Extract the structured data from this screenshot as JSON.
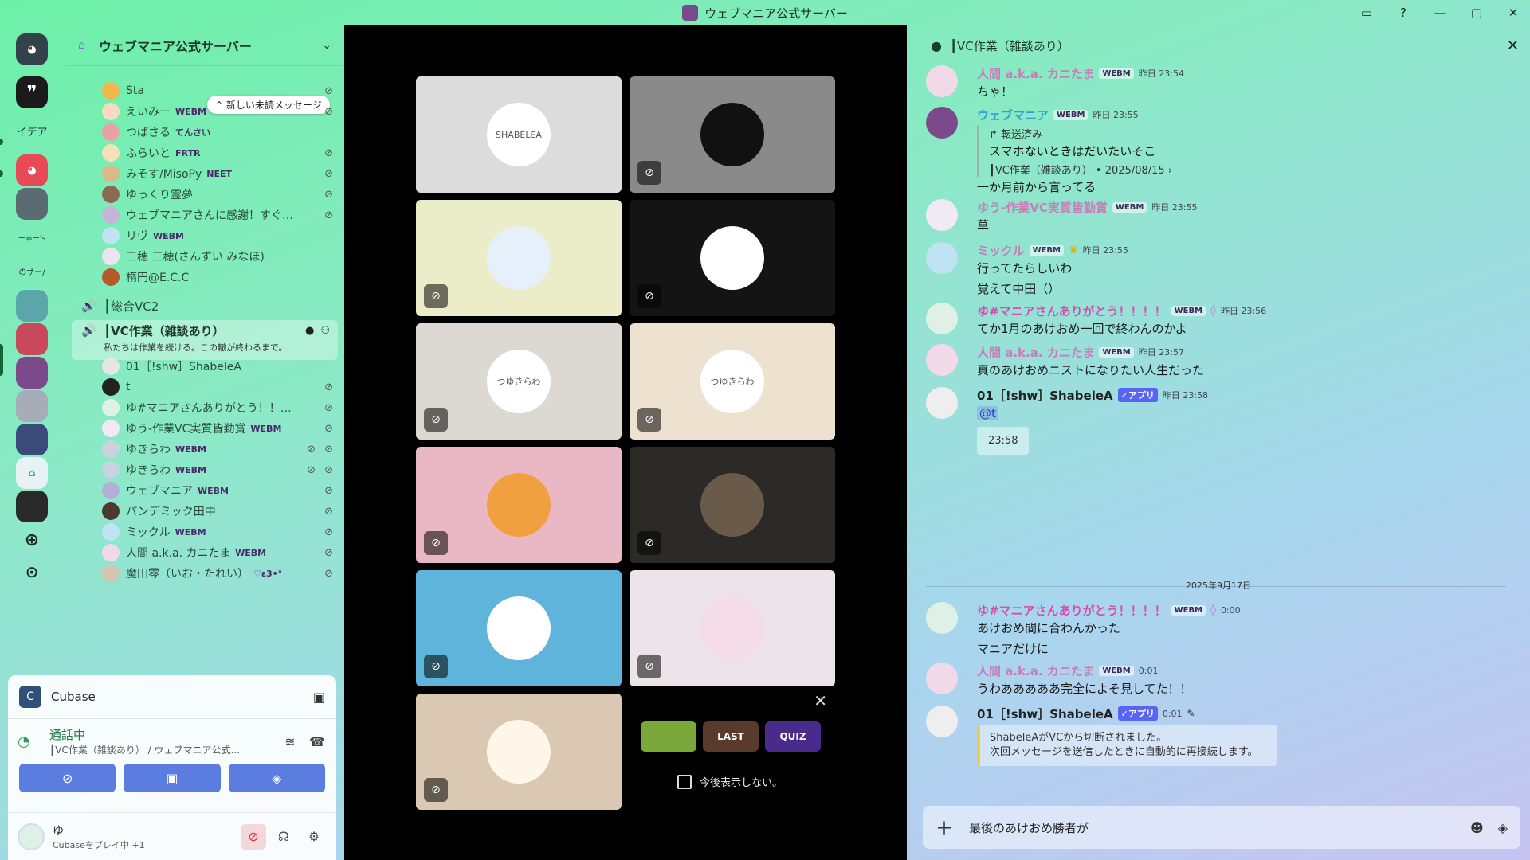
{
  "window": {
    "title": "ウェブマニア公式サーバー"
  },
  "rail": {
    "items": [
      "イデア",
      "ーゅー's",
      "のサー/"
    ]
  },
  "sidebar": {
    "server_name": "ウェブマニア公式サーバー",
    "tooltip": "新しい未読メッセージ",
    "top_members": [
      {
        "name": "Sta",
        "tag": "",
        "av": "#f0b84a"
      },
      {
        "name": "えいみー",
        "tag": "WEBM",
        "av": "#f7d9c4"
      },
      {
        "name": "つばさる",
        "tag": "てんさい",
        "av": "#e9a0a8"
      },
      {
        "name": "ふらいと",
        "tag": "FRTR",
        "av": "#f5e1b8"
      },
      {
        "name": "みそす/MisoPy",
        "tag": "NEET",
        "av": "#d9b98a"
      },
      {
        "name": "ゆっくり霊夢",
        "tag": "",
        "av": "#8a6a50"
      },
      {
        "name": "ウェブマニアさんに感謝！すぐ死...",
        "tag": "",
        "av": "#c6b3d9"
      },
      {
        "name": "リヴ",
        "tag": "WEBM",
        "av": "#bfe3f2"
      },
      {
        "name": "三穂 三穂(さんずい みなほ)",
        "tag": "",
        "av": "#ece4f2"
      },
      {
        "name": "楕円@E.C.C",
        "tag": "",
        "av": "#b55a2a"
      }
    ],
    "vc1": "┃総合VC2",
    "vc2": "┃VC作業（雑談あり）",
    "vc2_topic": "私たちは作業を続ける。この轍が終わるまで。",
    "vc_members": [
      {
        "name": "01［!shw］ShabeleA",
        "tag": "",
        "av": "#e6e6e6"
      },
      {
        "name": "t",
        "tag": "",
        "av": "#222"
      },
      {
        "name": "ゆ#マニアさんありがとう！！！！",
        "tag": "",
        "av": "#dff1e4"
      },
      {
        "name": "ゆう-作業VC実質皆勤賞",
        "tag": "WEBM",
        "av": "#f1e9f5"
      },
      {
        "name": "ゆきらわ",
        "tag": "WEBM",
        "av": "#c9d3e0"
      },
      {
        "name": "ゆきらわ",
        "tag": "WEBM",
        "av": "#c9d3e0"
      },
      {
        "name": "ウェブマニア",
        "tag": "WEBM",
        "av": "#b3aed6"
      },
      {
        "name": "パンデミック田中",
        "tag": "",
        "av": "#4a3a30"
      },
      {
        "name": "ミックル",
        "tag": "WEBM",
        "av": "#bfe3f2"
      },
      {
        "name": "人間 a.k.a. カニたま",
        "tag": "WEBM",
        "av": "#f2d9e8"
      },
      {
        "name": "魔田零（いお・たれい）",
        "tag": "♡ε3•°",
        "av": "#d6c4b0"
      }
    ]
  },
  "bottom": {
    "activity": "Cubase",
    "voice_status": "通話中",
    "voice_channel": "┃VC作業（雑談あり） / ウェブマニア公式...",
    "user_name": "ゆ",
    "user_status": "Cubaseをプレイ中 +1"
  },
  "stage": {
    "tiles": [
      {
        "bg": "#dcdcdc",
        "face": "#ffffff",
        "label": "SHABELEA",
        "muted": false
      },
      {
        "bg": "#8a8a8a",
        "face": "#111111",
        "label": "",
        "muted": true
      },
      {
        "bg": "#eaedc8",
        "face": "#e6f0fa",
        "label": "",
        "muted": true
      },
      {
        "bg": "#141414",
        "face": "#ffffff",
        "label": "",
        "muted": true
      },
      {
        "bg": "#dcd9d2",
        "face": "#ffffff",
        "label": "つゆきらわ",
        "muted": true
      },
      {
        "bg": "#ede1d0",
        "face": "#ffffff",
        "label": "つゆきらわ",
        "muted": true
      },
      {
        "bg": "#eab8c4",
        "face": "#f1a040",
        "label": "",
        "muted": true
      },
      {
        "bg": "#2b2a27",
        "face": "#6a5a4a",
        "label": "",
        "muted": true
      },
      {
        "bg": "#5fb4dc",
        "face": "#ffffff",
        "label": "",
        "muted": true
      },
      {
        "bg": "#ece4e8",
        "face": "#f4dce8",
        "label": "",
        "muted": true
      },
      {
        "bg": "#dbc8b2",
        "face": "#fff6ea",
        "label": "",
        "muted": true
      }
    ],
    "promo_games": [
      "",
      "LAST",
      "QUIZ"
    ],
    "promo_dont_show": "今後表示しない。"
  },
  "chat": {
    "title": "┃VC作業（雑談あり）",
    "messages": [
      {
        "user": "人間 a.k.a. カニたま",
        "color": "#c77db8",
        "badge": "WEBM",
        "ts": "昨日 23:54",
        "lines": [
          "ちゃ！"
        ]
      },
      {
        "user": "ウェブマニア",
        "color": "#2f9fd6",
        "badge": "WEBM",
        "ts": "昨日 23:55",
        "fwd_label": "↱ 転送済み",
        "fwd_text": "スマホないときはだいたいそこ",
        "fwd_src": "┃VC作業（雑談あり） • 2025/08/15 ›",
        "lines": [
          "一か月前から言ってる"
        ]
      },
      {
        "user": "ゆう-作業VC実質皆勤賞",
        "color": "#c77db8",
        "badge": "WEBM",
        "ts": "昨日 23:55",
        "lines": [
          "草"
        ]
      },
      {
        "user": "ミックル",
        "color": "#c77db8",
        "badge": "WEBM",
        "ts": "昨日 23:55",
        "lines": [
          "行ってたらしいわ",
          "覚えて中田（）"
        ]
      },
      {
        "user": "ゆ#マニアさんありがとう！！！！",
        "color": "#d64fb0",
        "badge": "WEBM",
        "ts": "昨日 23:56",
        "lines": [
          "てか1月のあけおめ一回で終わんのかよ"
        ]
      },
      {
        "user": "人間 a.k.a. カニたま",
        "color": "#c77db8",
        "badge": "WEBM",
        "ts": "昨日 23:57",
        "lines": [
          "真のあけおめニストになりたい人生だった"
        ]
      },
      {
        "user": "01［!shw］ShabeleA",
        "color": "#222222",
        "badge": "✓アプリ",
        "ts": "昨日 23:58",
        "mention": "@t",
        "embed": "23:58"
      },
      {
        "user": "ゆ#マニアさんありがとう！！！！",
        "color": "#d64fb0",
        "badge": "WEBM",
        "ts": "0:00",
        "lines": [
          "あけおめ間に合わんかった",
          "マニアだけに"
        ]
      },
      {
        "user": "人間 a.k.a. カニたま",
        "color": "#c77db8",
        "badge": "WEBM",
        "ts": "0:01",
        "lines": [
          "うわあああああ完全によそ見してた！！"
        ]
      },
      {
        "user": "01［!shw］ShabeleA",
        "color": "#222222",
        "badge": "✓アプリ",
        "ts": "0:01",
        "sys1": "ShabeleAがVCから切断されました。",
        "sys2": "次回メッセージを送信したときに自動的に再接続します。"
      }
    ],
    "date_divider": "2025年9月17日",
    "composer_text": "最後のあけおめ勝者が"
  }
}
